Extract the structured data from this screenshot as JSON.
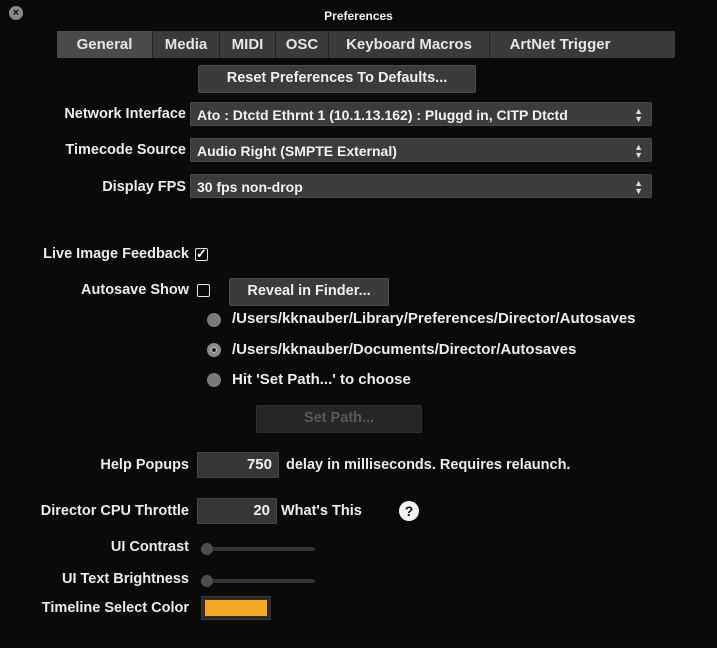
{
  "window": {
    "title": "Preferences"
  },
  "tabs": [
    {
      "label": "General"
    },
    {
      "label": "Media"
    },
    {
      "label": "MIDI"
    },
    {
      "label": "OSC"
    },
    {
      "label": "Keyboard Macros"
    },
    {
      "label": "ArtNet Trigger"
    }
  ],
  "active_tab": "General",
  "reset_button": {
    "label": "Reset Preferences To Defaults..."
  },
  "network_interface": {
    "label": "Network Interface",
    "value": "Ato : Dtctd Ethrnt 1 (10.1.13.162) : Pluggd in, CITP Dtctd"
  },
  "timecode_source": {
    "label": "Timecode Source",
    "value": "Audio Right (SMPTE External)"
  },
  "display_fps": {
    "label": "Display FPS",
    "value": "30 fps non-drop"
  },
  "live_image_feedback": {
    "label": "Live Image Feedback",
    "checked": true,
    "check_glyph": "✓"
  },
  "autosave_show": {
    "label": "Autosave Show",
    "checked": false
  },
  "reveal_button": {
    "label": "Reveal in Finder..."
  },
  "autosave_paths": [
    {
      "text": "/Users/kknauber/Library/Preferences/Director/Autosaves",
      "selected": false
    },
    {
      "text": "/Users/kknauber/Documents/Director/Autosaves",
      "selected": true
    },
    {
      "text": "Hit 'Set Path...' to choose",
      "selected": false
    }
  ],
  "set_path_button": {
    "label": "Set Path..."
  },
  "help_popups": {
    "label": "Help Popups",
    "value": "750",
    "suffix": "delay in milliseconds.  Requires relaunch."
  },
  "cpu_throttle": {
    "label": "Director CPU Throttle",
    "value": "20",
    "suffix": "What's This",
    "help_glyph": "?"
  },
  "ui_contrast": {
    "label": "UI Contrast",
    "level": 0
  },
  "ui_text_brightness": {
    "label": "UI Text Brightness",
    "level": 0
  },
  "timeline_select_color": {
    "label": "Timeline Select Color",
    "color": "#f5a623"
  },
  "icons": {
    "close": "close-icon",
    "stepper_arrows": "updown-arrows-icon"
  },
  "glyphs": {
    "close": "×",
    "arrow_up": "▲",
    "arrow_down": "▼"
  }
}
